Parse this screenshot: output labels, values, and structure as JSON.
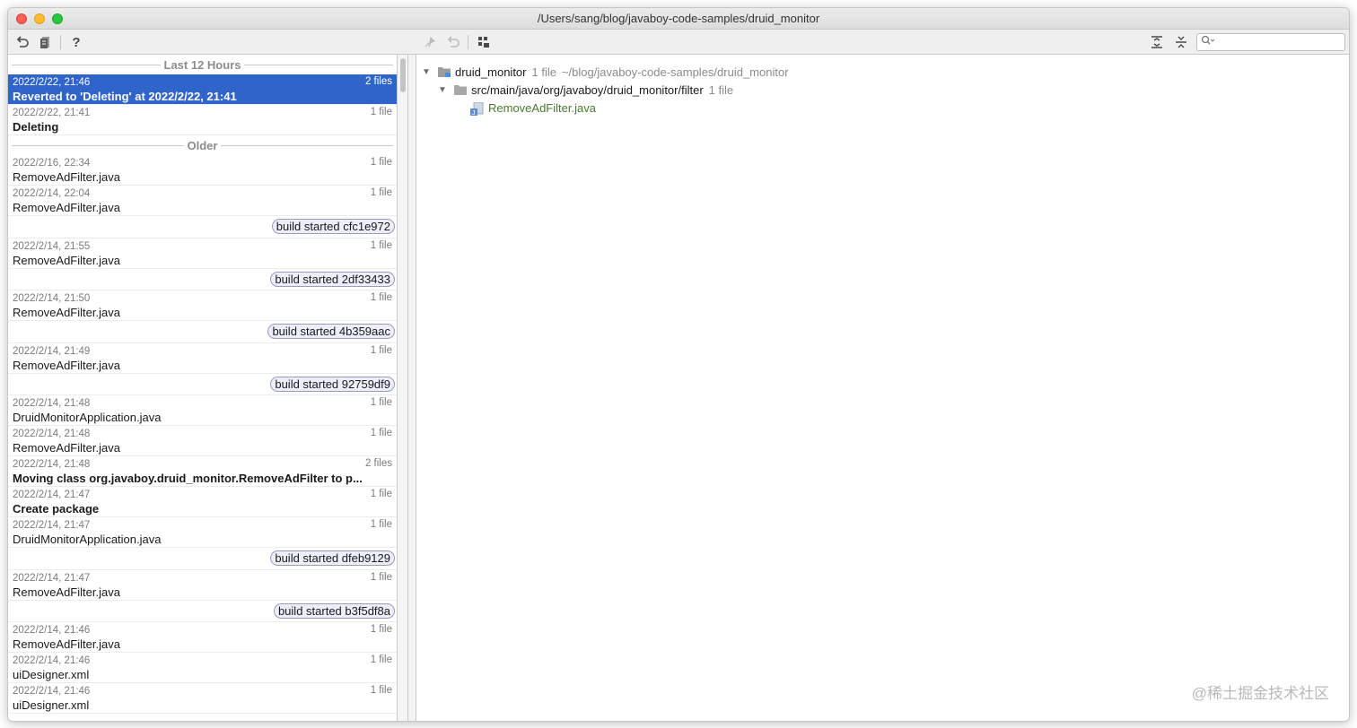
{
  "window": {
    "title": "/Users/sang/blog/javaboy-code-samples/druid_monitor"
  },
  "toolbar": {
    "left_icons": [
      "revert-icon",
      "patch-icon",
      "help-icon"
    ],
    "center_icons": [
      "pin-icon",
      "undo-icon",
      "group-icon"
    ],
    "right_icons": [
      "expand-all-icon",
      "collapse-all-icon"
    ],
    "help_glyph": "?",
    "search_placeholder": ""
  },
  "history": {
    "sections": [
      {
        "label": "Last 12 Hours",
        "entries": [
          {
            "date": "2022/2/22, 21:46",
            "count": "2 files",
            "name": "Reverted to 'Deleting' at 2022/2/22, 21:41",
            "bold": true,
            "selected": true
          },
          {
            "date": "2022/2/22, 21:41",
            "count": "1 file",
            "name": "Deleting",
            "bold": true,
            "selected": false
          }
        ]
      },
      {
        "label": "Older",
        "entries": [
          {
            "date": "2022/2/16, 22:34",
            "count": "1 file",
            "name": "RemoveAdFilter.java"
          },
          {
            "date": "2022/2/14, 22:04",
            "count": "1 file",
            "name": "RemoveAdFilter.java"
          },
          {
            "badge": "build started cfc1e972"
          },
          {
            "date": "2022/2/14, 21:55",
            "count": "1 file",
            "name": "RemoveAdFilter.java"
          },
          {
            "badge": "build started 2df33433"
          },
          {
            "date": "2022/2/14, 21:50",
            "count": "1 file",
            "name": "RemoveAdFilter.java"
          },
          {
            "badge": "build started 4b359aac"
          },
          {
            "date": "2022/2/14, 21:49",
            "count": "1 file",
            "name": "RemoveAdFilter.java"
          },
          {
            "badge": "build started 92759df9"
          },
          {
            "date": "2022/2/14, 21:48",
            "count": "1 file",
            "name": "DruidMonitorApplication.java"
          },
          {
            "date": "2022/2/14, 21:48",
            "count": "1 file",
            "name": "RemoveAdFilter.java"
          },
          {
            "date": "2022/2/14, 21:48",
            "count": "2 files",
            "name": "Moving class org.javaboy.druid_monitor.RemoveAdFilter to p...",
            "bold": true
          },
          {
            "date": "2022/2/14, 21:47",
            "count": "1 file",
            "name": "Create package",
            "bold": true
          },
          {
            "date": "2022/2/14, 21:47",
            "count": "1 file",
            "name": "DruidMonitorApplication.java"
          },
          {
            "badge": "build started dfeb9129"
          },
          {
            "date": "2022/2/14, 21:47",
            "count": "1 file",
            "name": "RemoveAdFilter.java"
          },
          {
            "badge": "build started b3f5df8a"
          },
          {
            "date": "2022/2/14, 21:46",
            "count": "1 file",
            "name": "RemoveAdFilter.java"
          },
          {
            "date": "2022/2/14, 21:46",
            "count": "1 file",
            "name": "uiDesigner.xml"
          },
          {
            "date": "2022/2/14, 21:46",
            "count": "1 file",
            "name": "uiDesigner.xml"
          }
        ]
      }
    ]
  },
  "tree": {
    "root": {
      "name": "druid_monitor",
      "count": "1 file",
      "path": "~/blog/javaboy-code-samples/druid_monitor"
    },
    "folder": {
      "name": "src/main/java/org/javaboy/druid_monitor/filter",
      "count": "1 file"
    },
    "file": {
      "name": "RemoveAdFilter.java"
    }
  },
  "watermark": "@稀土掘金技术社区",
  "colors": {
    "selection": "#2f65ca",
    "java_file": "#4b7a2a",
    "badge_border": "#9a9ac4"
  }
}
